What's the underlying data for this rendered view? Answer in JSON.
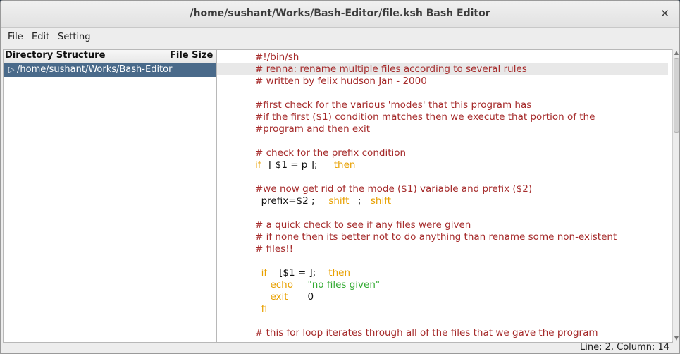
{
  "window": {
    "title": "/home/sushant/Works/Bash-Editor/file.ksh Bash Editor",
    "close_glyph": "✕"
  },
  "menu": [
    {
      "label": "File"
    },
    {
      "label": "Edit"
    },
    {
      "label": "Setting"
    }
  ],
  "tree": {
    "headers": {
      "directory": "Directory Structure",
      "size": "File Size"
    },
    "items": [
      {
        "label": "/home/sushant/Works/Bash-Editor",
        "icon": "chevron-right-icon",
        "selected": true
      }
    ]
  },
  "editor": {
    "lines": [
      [
        {
          "t": "#!/bin/sh",
          "c": "comment"
        }
      ],
      [
        {
          "t": "# renna: rename multiple files according to several rules",
          "c": "comment"
        }
      ],
      [
        {
          "t": "# written by felix hudson Jan - 2000",
          "c": "comment"
        }
      ],
      [],
      [
        {
          "t": "#first check for the various 'modes' that this program has",
          "c": "comment"
        }
      ],
      [
        {
          "t": "#if the first ($1) condition matches then we execute that portion of the",
          "c": "comment"
        }
      ],
      [
        {
          "t": "#program and then exit",
          "c": "comment"
        }
      ],
      [],
      [
        {
          "t": "# check for the prefix condition",
          "c": "comment"
        }
      ],
      [
        {
          "t": "if",
          "c": "keyword"
        },
        {
          "t": " [ $1 = p ]; ",
          "c": "plain"
        },
        {
          "t": "then",
          "c": "keyword"
        }
      ],
      [],
      [
        {
          "t": "#we now get rid of the mode ($1) variable and prefix ($2)",
          "c": "comment"
        }
      ],
      [
        {
          "t": "  prefix=$2 ; ",
          "c": "plain"
        },
        {
          "t": "shift",
          "c": "keyword"
        },
        {
          "t": " ; ",
          "c": "plain"
        },
        {
          "t": "shift",
          "c": "keyword"
        }
      ],
      [],
      [
        {
          "t": "# a quick check to see if any files were given",
          "c": "comment"
        }
      ],
      [
        {
          "t": "# if none then its better not to do anything than rename some non-existent",
          "c": "comment"
        }
      ],
      [
        {
          "t": "# files!!",
          "c": "comment"
        }
      ],
      [],
      [
        {
          "t": "  if",
          "c": "keyword"
        },
        {
          "t": " [$1 = ]; ",
          "c": "plain"
        },
        {
          "t": "then",
          "c": "keyword"
        }
      ],
      [
        {
          "t": "     echo ",
          "c": "keyword"
        },
        {
          "t": "\"no files given\"",
          "c": "string"
        }
      ],
      [
        {
          "t": "     exit ",
          "c": "keyword"
        },
        {
          "t": "0",
          "c": "plain"
        }
      ],
      [
        {
          "t": "  fi",
          "c": "keyword"
        }
      ],
      [],
      [
        {
          "t": "# this for loop iterates through all of the files that we gave the program",
          "c": "comment"
        }
      ]
    ],
    "current_line_index": 1,
    "scroll_position": 0.0
  },
  "status": {
    "text": "Line: 2, Column: 14"
  },
  "colors": {
    "comment": "#a52a2a",
    "keyword": "#e8a000",
    "string": "#33aa33",
    "selection": "#4a6a8a"
  }
}
